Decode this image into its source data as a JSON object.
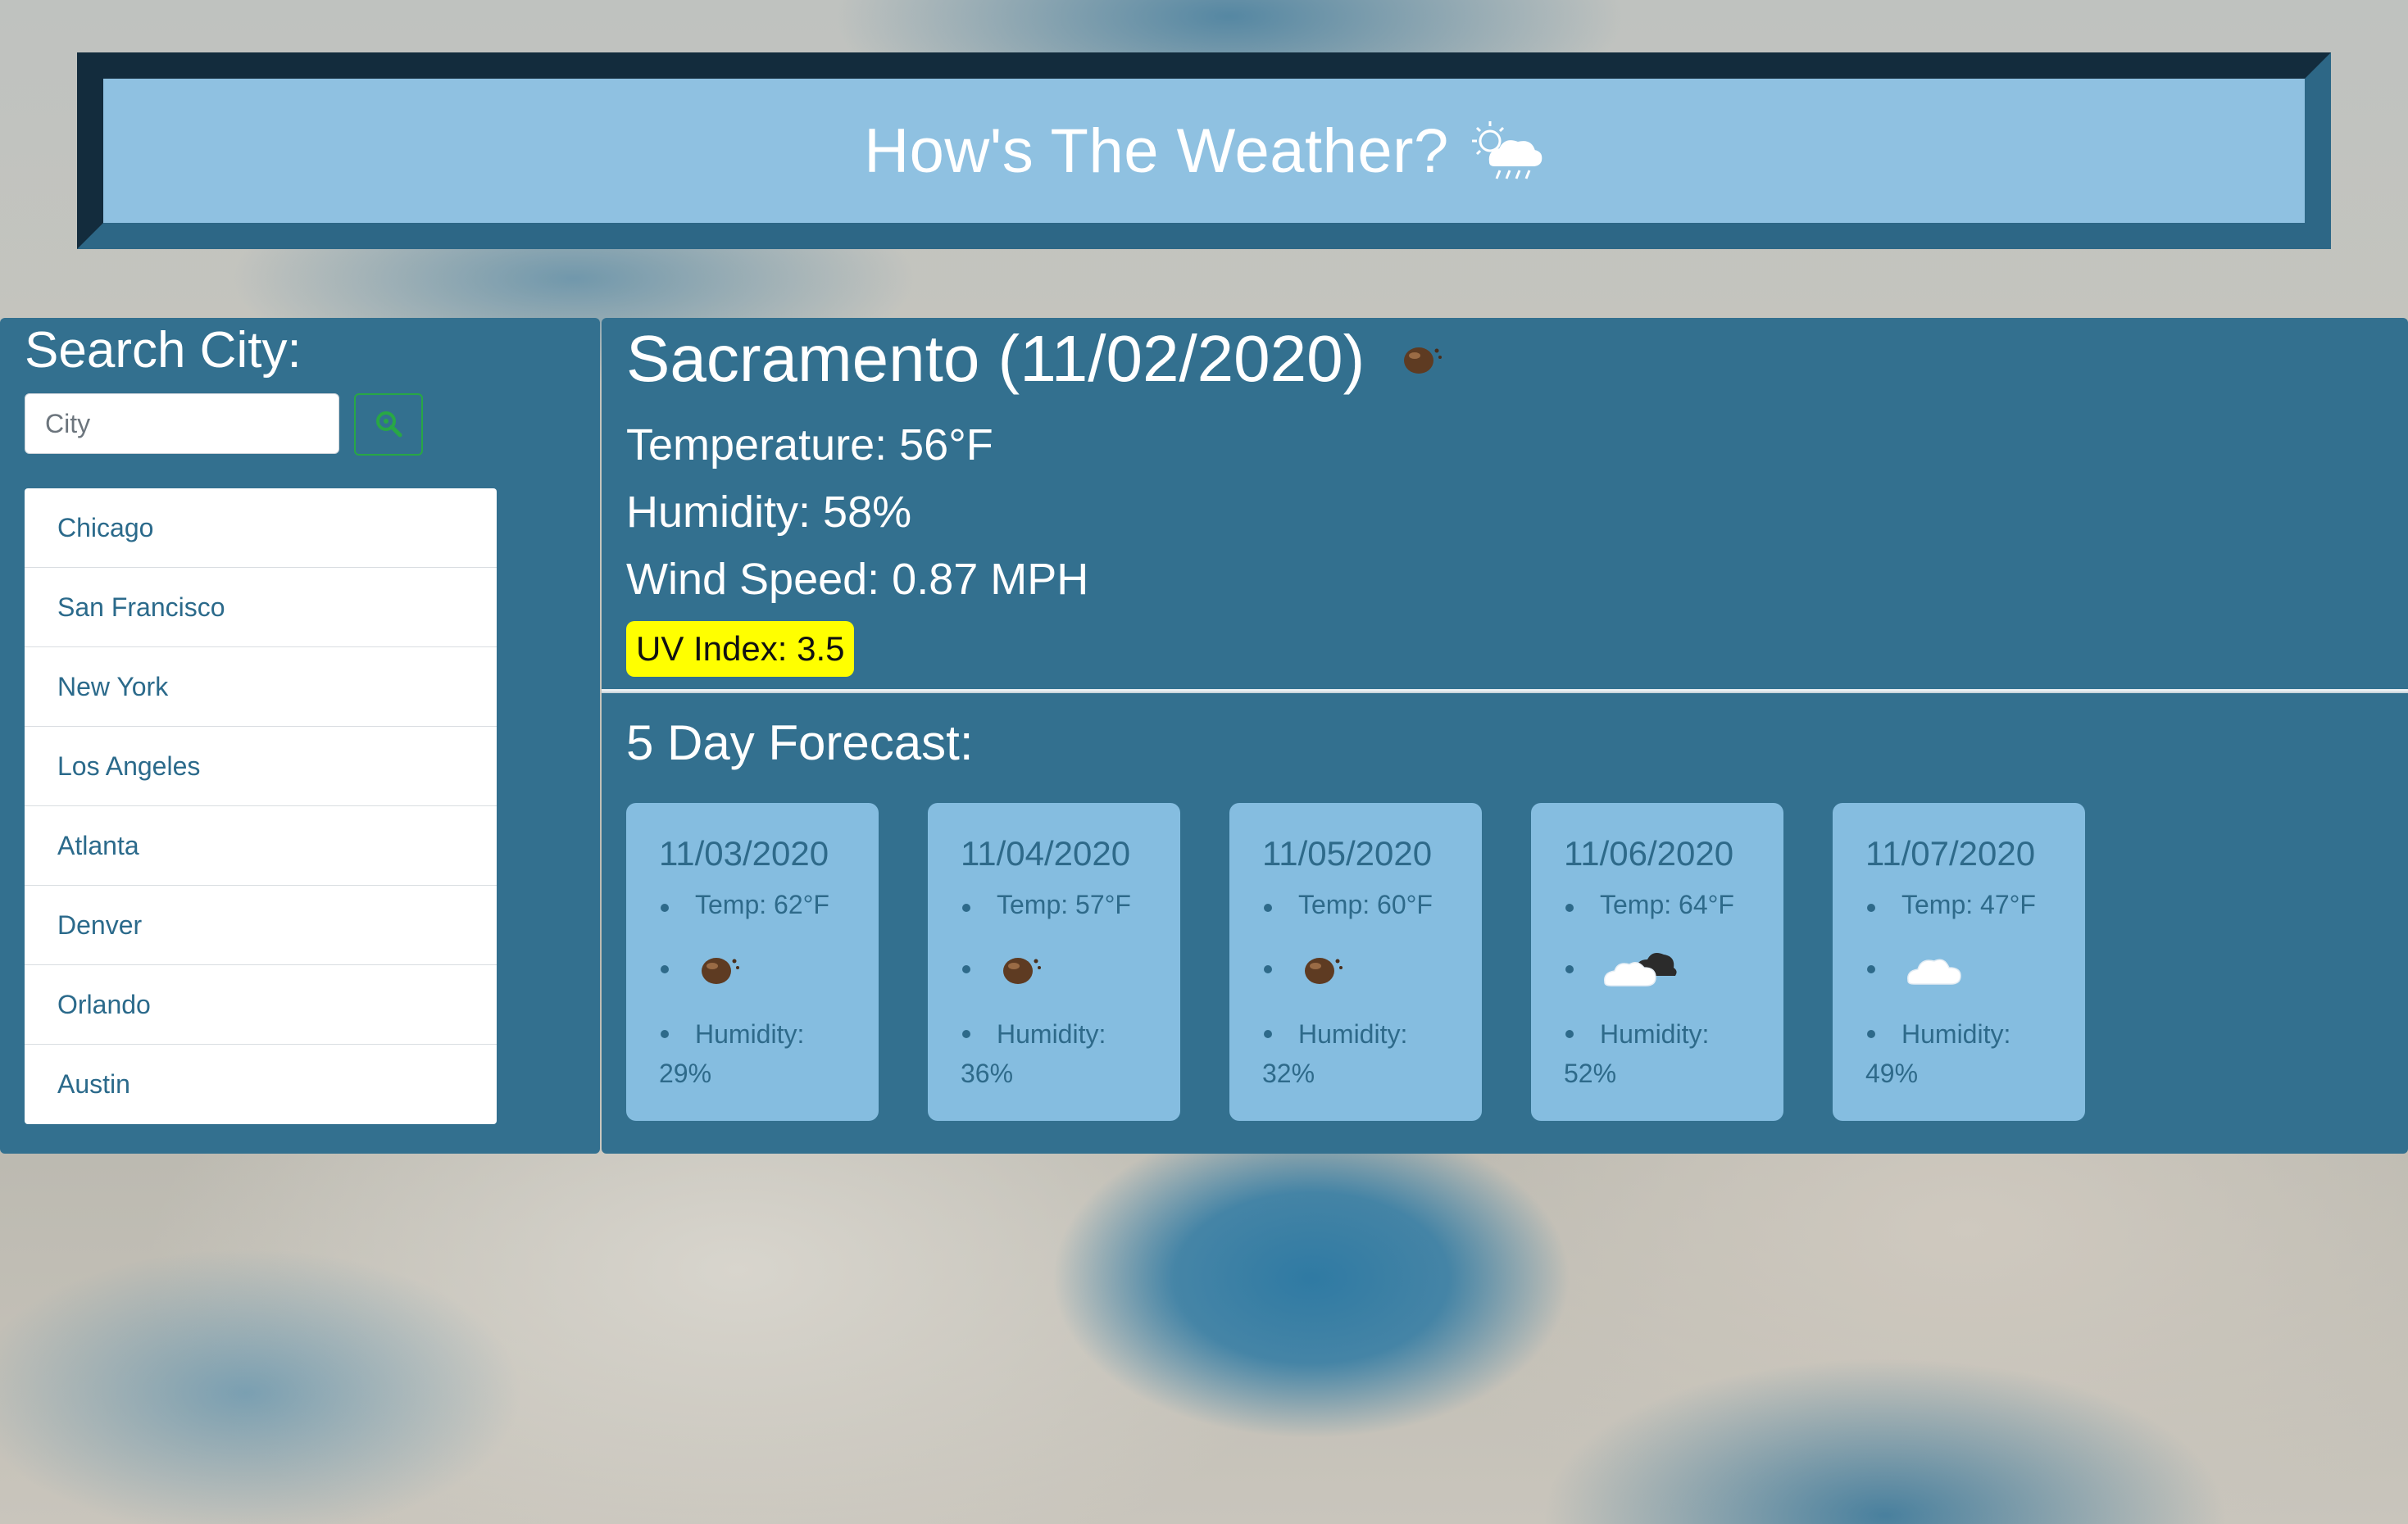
{
  "header": {
    "title": "How's The Weather?",
    "icon": "sun-cloud-rain-icon"
  },
  "search": {
    "label": "Search City:",
    "placeholder": "City",
    "value": "",
    "button_icon": "search-icon",
    "button_color": "#28a745"
  },
  "cities": [
    "Chicago",
    "San Francisco",
    "New York",
    "Los Angeles",
    "Atlanta",
    "Denver",
    "Orlando",
    "Austin"
  ],
  "current": {
    "title": "Sacramento (11/02/2020)",
    "icon": "haze-icon",
    "temperature": "Temperature: 56°F",
    "humidity": "Humidity: 58%",
    "wind": "Wind Speed: 0.87 MPH",
    "uv": "UV Index: 3.5",
    "uv_color": "#ffff00"
  },
  "forecast": {
    "heading": "5 Day Forecast:",
    "days": [
      {
        "date": "11/03/2020",
        "temp": "Temp: 62°F",
        "icon": "haze-icon",
        "humidity_label": "Humidity:",
        "humidity_value": "29%"
      },
      {
        "date": "11/04/2020",
        "temp": "Temp: 57°F",
        "icon": "haze-icon",
        "humidity_label": "Humidity:",
        "humidity_value": "36%"
      },
      {
        "date": "11/05/2020",
        "temp": "Temp: 60°F",
        "icon": "haze-icon",
        "humidity_label": "Humidity:",
        "humidity_value": "32%"
      },
      {
        "date": "11/06/2020",
        "temp": "Temp: 64°F",
        "icon": "broken-clouds-icon",
        "humidity_label": "Humidity:",
        "humidity_value": "52%"
      },
      {
        "date": "11/07/2020",
        "temp": "Temp: 47°F",
        "icon": "cloud-icon",
        "humidity_label": "Humidity:",
        "humidity_value": "49%"
      }
    ]
  },
  "colors": {
    "panel": "#33708f",
    "header_bg": "#8fc1e1",
    "card_bg": "#85bde0"
  }
}
